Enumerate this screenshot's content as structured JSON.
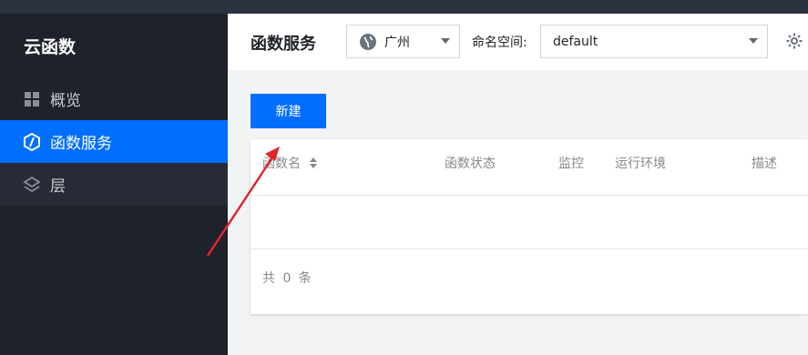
{
  "sidebar": {
    "brand": "云函数",
    "items": [
      {
        "label": "概览",
        "icon": "grid-icon"
      },
      {
        "label": "函数服务",
        "icon": "function-icon",
        "active": true
      },
      {
        "label": "层",
        "icon": "layers-icon"
      }
    ]
  },
  "header": {
    "title": "函数服务",
    "region": {
      "value": "广州",
      "icon": "globe-icon"
    },
    "namespace": {
      "label": "命名空间:",
      "value": "default"
    },
    "settings_icon": "gear-icon"
  },
  "toolbar": {
    "new_label": "新建"
  },
  "table": {
    "columns": [
      "函数名",
      "函数状态",
      "监控",
      "运行环境",
      "描述"
    ],
    "rows": [],
    "footer": "共 0 条"
  },
  "colors": {
    "accent": "#006eff",
    "sidebar_bg": "#1e222b",
    "annotation_arrow": "#e0262b"
  }
}
